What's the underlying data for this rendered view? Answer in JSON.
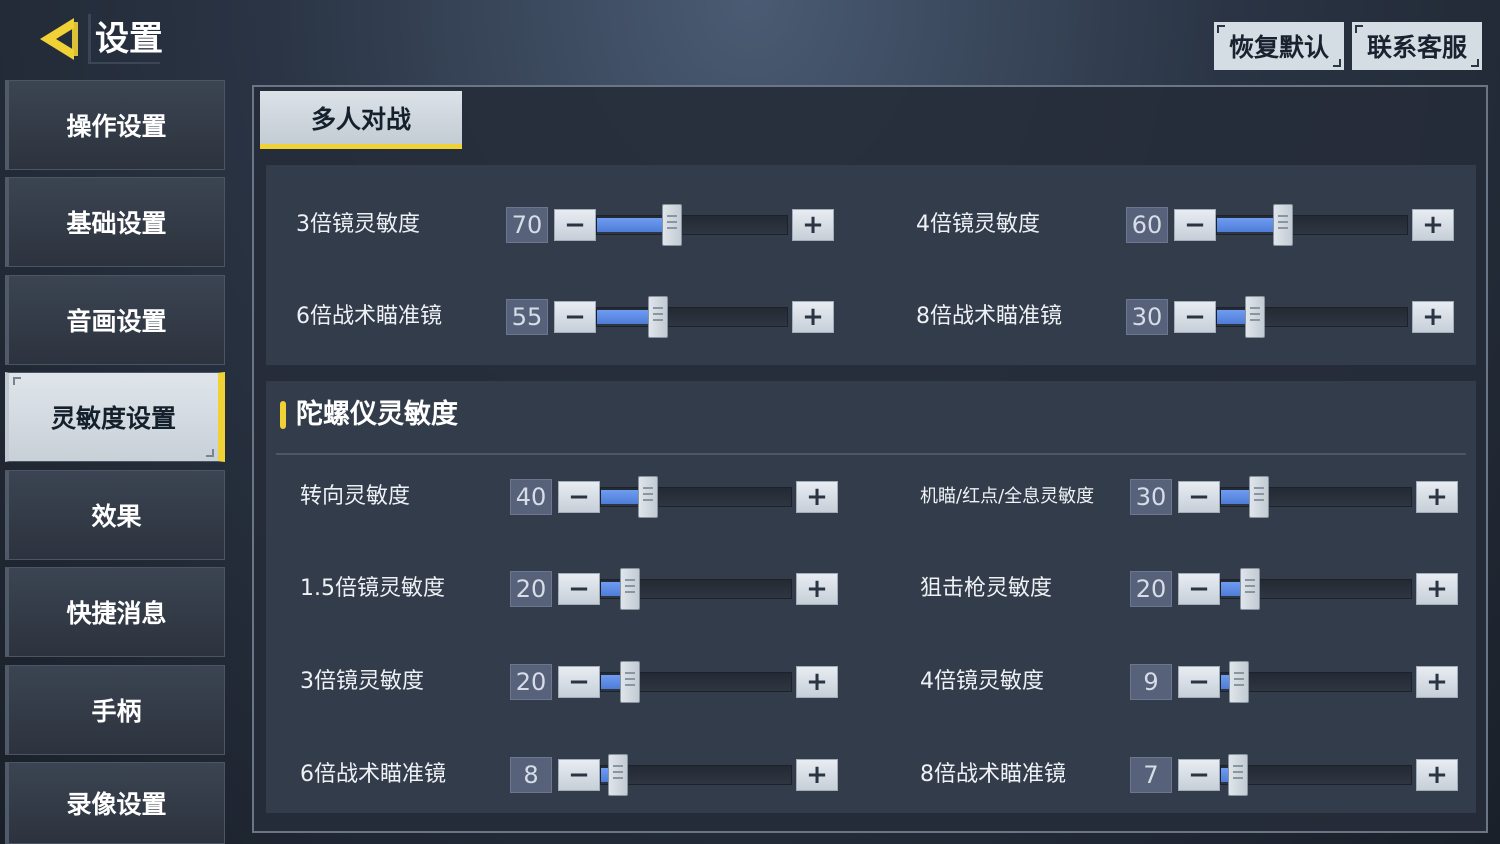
{
  "header": {
    "title": "设置",
    "buttons": {
      "reset": "恢复默认",
      "support": "联系客服"
    }
  },
  "sidebar": {
    "items": [
      {
        "label": "操作设置",
        "active": false
      },
      {
        "label": "基础设置",
        "active": false
      },
      {
        "label": "音画设置",
        "active": false
      },
      {
        "label": "灵敏度设置",
        "active": true
      },
      {
        "label": "效果",
        "active": false
      },
      {
        "label": "快捷消息",
        "active": false
      },
      {
        "label": "手柄",
        "active": false
      },
      {
        "label": "录像设置",
        "active": false
      }
    ]
  },
  "tab": {
    "label": "多人对战"
  },
  "scope_panel": {
    "rows": [
      {
        "label": "3倍镜灵敏度",
        "value": "70"
      },
      {
        "label": "4倍镜灵敏度",
        "value": "60"
      },
      {
        "label": "6倍战术瞄准镜",
        "value": "55"
      },
      {
        "label": "8倍战术瞄准镜",
        "value": "30"
      }
    ]
  },
  "gyro_panel": {
    "title": "陀螺仪灵敏度",
    "rows": [
      {
        "label": "转向灵敏度",
        "value": "40"
      },
      {
        "label": "机瞄/红点/全息灵敏度",
        "value": "30"
      },
      {
        "label": "1.5倍镜灵敏度",
        "value": "20"
      },
      {
        "label": "狙击枪灵敏度",
        "value": "20"
      },
      {
        "label": "3倍镜灵敏度",
        "value": "20"
      },
      {
        "label": "4倍镜灵敏度",
        "value": "9"
      },
      {
        "label": "6倍战术瞄准镜",
        "value": "8"
      },
      {
        "label": "8倍战术瞄准镜",
        "value": "7"
      }
    ]
  },
  "controls": {
    "minus": "−",
    "plus": "+"
  },
  "colors": {
    "accent": "#f1d236",
    "slider_fill": "#5a88e0",
    "panel": "#333c4a"
  },
  "icons": {
    "back": "back-arrow-icon"
  }
}
